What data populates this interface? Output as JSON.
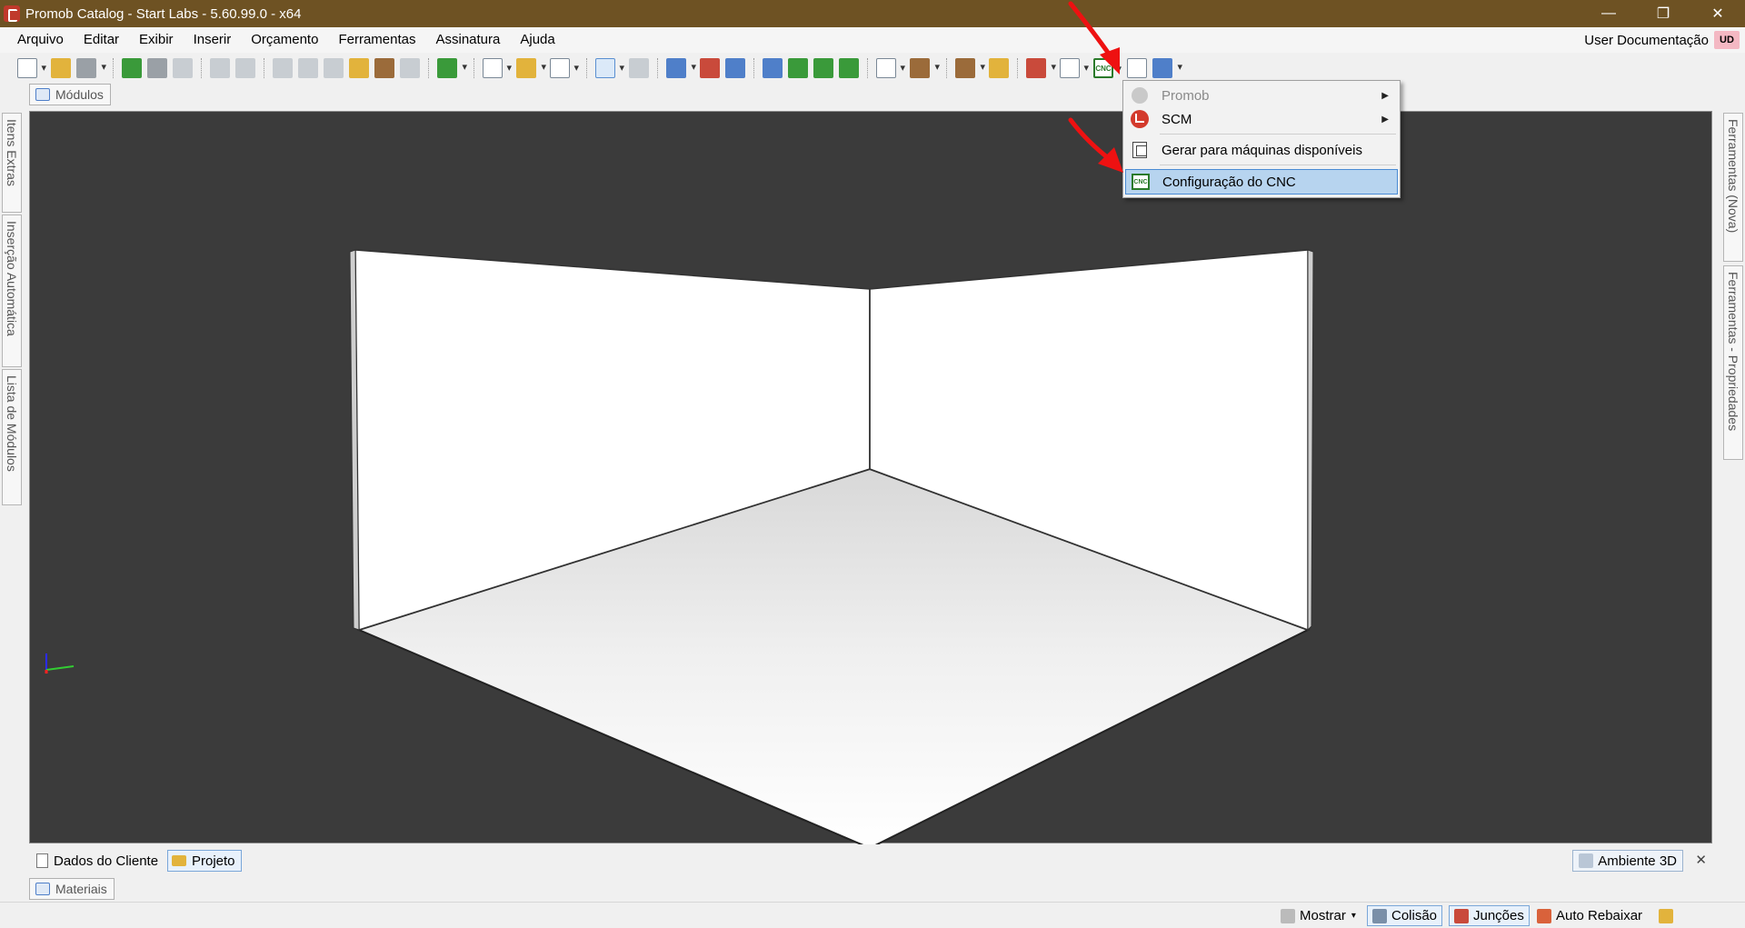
{
  "window": {
    "title": "Promob Catalog - Start Labs - 5.60.99.0 - x64",
    "min": "—",
    "max": "❐",
    "close": "✕"
  },
  "menu": {
    "items": [
      "Arquivo",
      "Editar",
      "Exibir",
      "Inserir",
      "Orçamento",
      "Ferramentas",
      "Assinatura",
      "Ajuda"
    ],
    "user": "User Documentação",
    "user_badge": "UD"
  },
  "toolbar": {
    "cnc_label": "CNC"
  },
  "panels": {
    "modulos": "Módulos",
    "left_tabs": [
      "Itens Extras",
      "Inserção Automática",
      "Lista de Módulos"
    ],
    "right_tabs": [
      "Ferramentas (Nova)",
      "Ferramentas - Propriedades"
    ]
  },
  "dropdown": {
    "items": [
      {
        "label": "Promob",
        "icon": "promob-icon",
        "submenu": true,
        "disabled": true
      },
      {
        "label": "SCM",
        "icon": "scm-icon",
        "submenu": true,
        "disabled": false
      },
      {
        "label": "Gerar para máquinas disponíveis",
        "icon": "generate-icon",
        "submenu": false,
        "disabled": false
      },
      {
        "label": "Configuração do CNC",
        "icon": "cnc-icon",
        "submenu": false,
        "disabled": false,
        "selected": true
      }
    ],
    "cnc_icon_text": "CNC"
  },
  "bottom_tabs": {
    "dados": "Dados do Cliente",
    "projeto": "Projeto",
    "ambiente": "Ambiente 3D",
    "close": "✕"
  },
  "materials_tab": "Materiais",
  "status": {
    "mostrar": "Mostrar",
    "colisao": "Colisão",
    "juncoes": "Junções",
    "auto": "Auto Rebaixar"
  },
  "colors": {
    "titlebar": "#6e5223",
    "viewport_bg": "#3b3b3b",
    "highlight": "#b7d4ef",
    "annotation_red": "#ee1111"
  }
}
